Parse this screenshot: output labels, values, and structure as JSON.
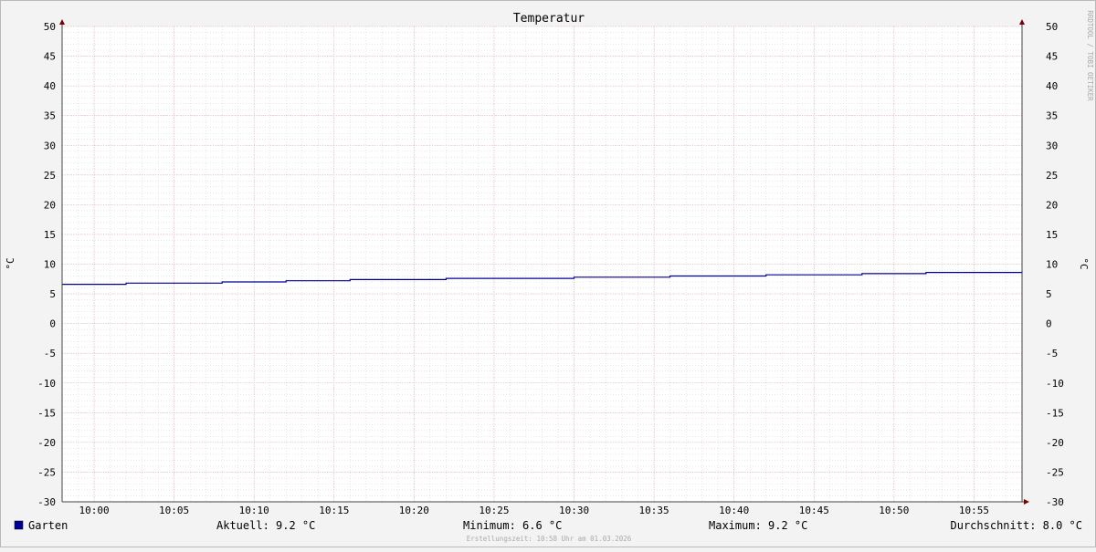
{
  "chart_data": {
    "type": "line",
    "title": "Temperatur",
    "ylabel": "°C",
    "watermark": "RRDTOOL / TOBI OETIKER",
    "ylim": [
      -30,
      50
    ],
    "y_ticks": [
      "50",
      "45",
      "40",
      "35",
      "30",
      "25",
      "20",
      "15",
      "10",
      "5",
      "0",
      "-5",
      "-10",
      "-15",
      "-20",
      "-25",
      "-30"
    ],
    "x_ticks": [
      "10:00",
      "10:05",
      "10:10",
      "10:15",
      "10:20",
      "10:25",
      "10:30",
      "10:35",
      "10:40",
      "10:45",
      "10:50",
      "10:55"
    ],
    "x_range_minutes": [
      -2,
      58
    ],
    "grid": true,
    "series": [
      {
        "name": "Garten",
        "color": "#000099",
        "step": true,
        "x_minutes": [
          -2,
          2,
          8,
          12,
          16,
          22,
          30,
          36,
          42,
          48,
          52,
          58
        ],
        "values": [
          6.6,
          6.8,
          7.0,
          7.2,
          7.4,
          7.6,
          7.8,
          8.0,
          8.2,
          8.4,
          8.6,
          8.8
        ]
      }
    ]
  },
  "legend": {
    "series_label": "Garten",
    "swatch_color": "#000099",
    "current": "Aktuell: 9.2 °C",
    "minimum": "Minimum: 6.6 °C",
    "maximum": "Maximum: 9.2 °C",
    "average": "Durchschnitt: 8.0 °C"
  },
  "footer": "Erstellungszeit: 10:58 Uhr am 01.03.2026",
  "colors": {
    "background": "#f3f3f3",
    "plot_background": "#ffffff",
    "major_grid": "#e3a0a0",
    "minor_grid": "#cfcfcf",
    "axis": "#7a0000"
  }
}
